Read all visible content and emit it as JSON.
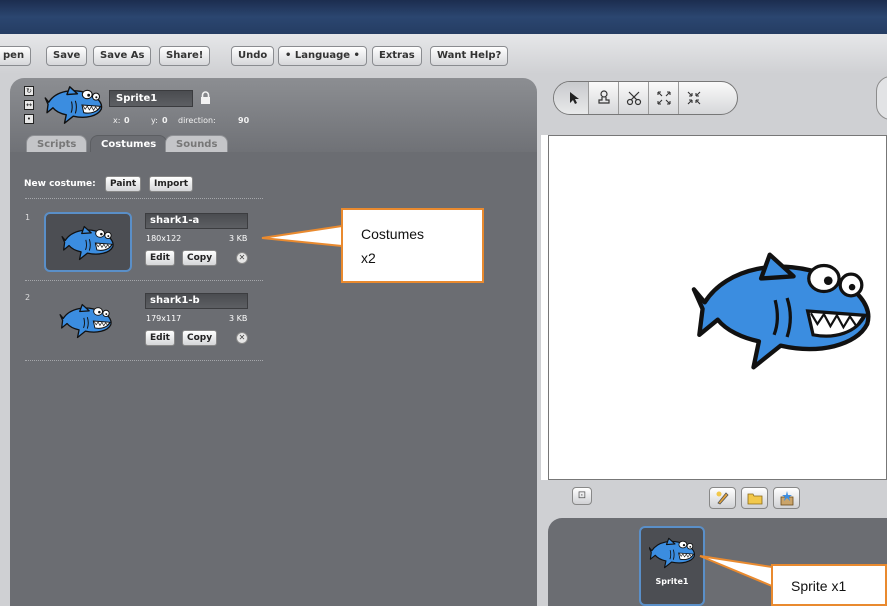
{
  "menu": {
    "open": "pen",
    "save": "Save",
    "save_as": "Save As",
    "share": "Share!",
    "undo": "Undo",
    "language": "• Language •",
    "extras": "Extras",
    "want_help": "Want Help?"
  },
  "sprite": {
    "name": "Sprite1",
    "x_label": "x:",
    "x_value": "0",
    "y_label": "y:",
    "y_value": "0",
    "direction_label": "direction:",
    "direction_value": "90"
  },
  "tabs": {
    "scripts": "Scripts",
    "costumes": "Costumes",
    "sounds": "Sounds"
  },
  "costumes_panel": {
    "new_costume_label": "New costume:",
    "paint": "Paint",
    "import": "Import",
    "items": [
      {
        "index": "1",
        "name": "shark1-a",
        "size": "180x122",
        "kb": "3 KB",
        "edit": "Edit",
        "copy": "Copy"
      },
      {
        "index": "2",
        "name": "shark1-b",
        "size": "179x117",
        "kb": "3 KB",
        "edit": "Edit",
        "copy": "Copy"
      }
    ]
  },
  "sprite_list": {
    "items": [
      {
        "name": "Sprite1"
      }
    ]
  },
  "callouts": {
    "costumes_line1": "Costumes",
    "costumes_line2": "x2",
    "sprite": "Sprite x1"
  },
  "icons": [
    "arrow-pointer-icon",
    "stamp-icon",
    "scissors-icon",
    "grow-icon",
    "shrink-icon",
    "presentation-mode-icon",
    "paint-new-sprite-icon",
    "choose-sprite-file-icon",
    "surprise-sprite-icon",
    "lock-icon",
    "delete-costume-icon",
    "rotation-style-icon",
    "shark-icon"
  ],
  "colors": {
    "accent_blue": "#3b8de0",
    "panel_gray": "#6b6d72",
    "callout_orange": "#e98a2f"
  }
}
